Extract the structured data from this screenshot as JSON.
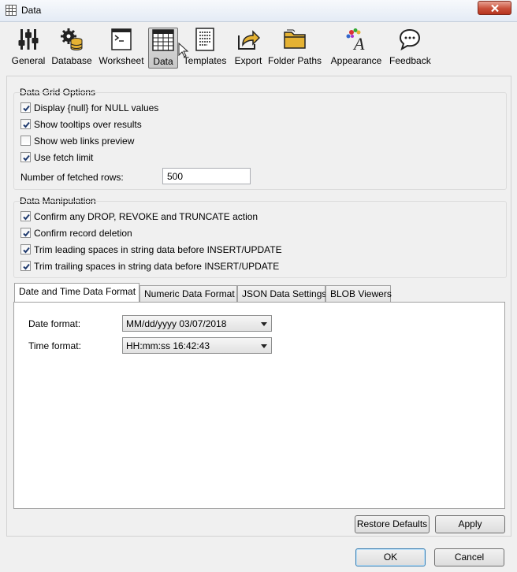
{
  "window": {
    "title": "Data"
  },
  "toolbar": {
    "items": [
      {
        "label": "General",
        "icon": "sliders-icon"
      },
      {
        "label": "Database",
        "icon": "database-gear-icon"
      },
      {
        "label": "Worksheet",
        "icon": "worksheet-icon"
      },
      {
        "label": "Data",
        "icon": "grid-icon",
        "active": true
      },
      {
        "label": "Templates",
        "icon": "templates-icon"
      },
      {
        "label": "Export",
        "icon": "export-icon"
      },
      {
        "label": "Folder Paths",
        "icon": "folder-icon"
      },
      {
        "label": "Appearance",
        "icon": "appearance-icon"
      },
      {
        "label": "Feedback",
        "icon": "speech-bubble-icon"
      }
    ]
  },
  "grid_options": {
    "title": "Data Grid Options",
    "checkboxes": [
      {
        "label": "Display {null} for NULL values",
        "checked": true
      },
      {
        "label": "Show tooltips over results",
        "checked": true
      },
      {
        "label": "Show web links preview",
        "checked": false
      },
      {
        "label": "Use fetch limit",
        "checked": true
      }
    ],
    "fetched_rows_label": "Number of fetched rows:",
    "fetched_rows_value": "500"
  },
  "manipulation": {
    "title": "Data Manipulation",
    "checkboxes": [
      {
        "label": "Confirm any DROP, REVOKE and TRUNCATE action",
        "checked": true
      },
      {
        "label": "Confirm record deletion",
        "checked": true
      },
      {
        "label": "Trim leading spaces in string data before INSERT/UPDATE",
        "checked": true
      },
      {
        "label": "Trim trailing spaces in string data before INSERT/UPDATE",
        "checked": true
      }
    ]
  },
  "tabs": [
    {
      "label": "Date and Time Data Format",
      "active": true
    },
    {
      "label": "Numeric Data Format"
    },
    {
      "label": "JSON Data Settings"
    },
    {
      "label": "BLOB Viewers"
    }
  ],
  "date_time": {
    "date_label": "Date format:",
    "date_value": "MM/dd/yyyy 03/07/2018",
    "time_label": "Time format:",
    "time_value": "HH:mm:ss 16:42:43"
  },
  "buttons": {
    "restore_defaults": "Restore Defaults",
    "apply": "Apply",
    "ok": "OK",
    "cancel": "Cancel"
  },
  "colors": {
    "check": "#1f3a6e",
    "icon_dark": "#222222",
    "folder": "#e5b233",
    "active_tool_bg": "#d0d0d0"
  }
}
